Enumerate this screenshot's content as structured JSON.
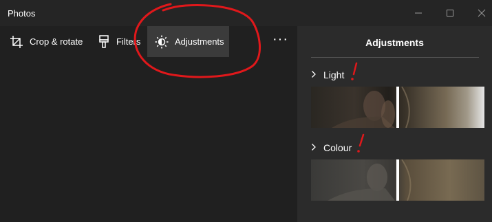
{
  "window": {
    "title": "Photos"
  },
  "window_controls": [
    "minimize-icon",
    "maximize-icon",
    "close-icon"
  ],
  "toolbar": {
    "items": [
      {
        "label": "Crop & rotate",
        "icon": "crop-icon"
      },
      {
        "label": "Filters",
        "icon": "brush-icon"
      },
      {
        "label": "Adjustments",
        "icon": "brightness-icon",
        "active": true
      }
    ],
    "more_label": "···"
  },
  "panel": {
    "title": "Adjustments",
    "sections": [
      {
        "label": "Light",
        "icon": "chevron-right-icon",
        "slider_value": 0.5
      },
      {
        "label": "Colour",
        "icon": "chevron-right-icon",
        "slider_value": 0.5
      }
    ]
  },
  "colors": {
    "titlebar": "#252525",
    "background": "#202020",
    "panel": "#2b2b2b",
    "active_tool": "#3b3b3b",
    "annotation": "#e0181b"
  }
}
